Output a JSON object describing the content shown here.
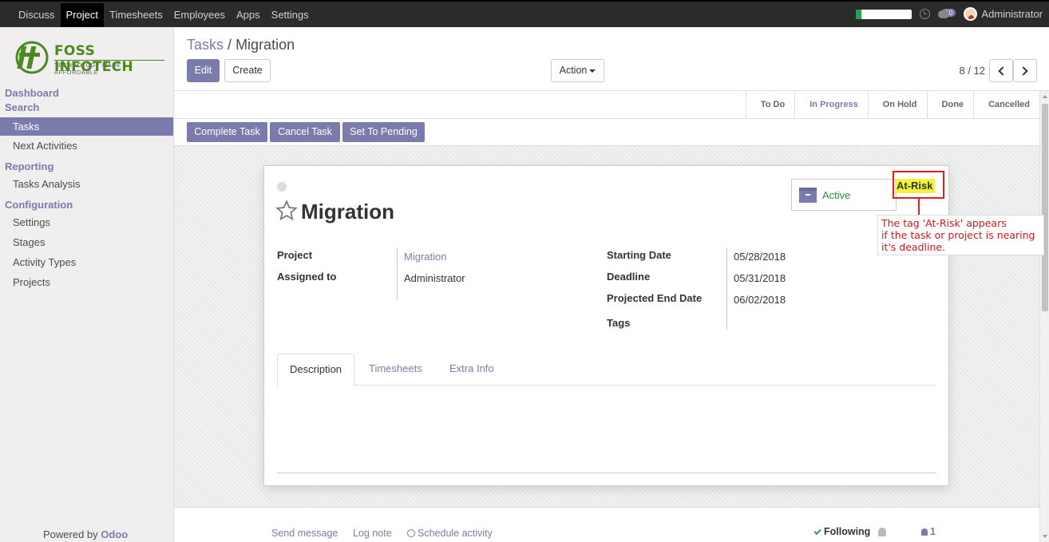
{
  "topbar": {
    "menu": [
      "Discuss",
      "Project",
      "Timesheets",
      "Employees",
      "Apps",
      "Settings"
    ],
    "active_menu": "Project",
    "notification_count": "10",
    "user": "Administrator",
    "progress": 0.1
  },
  "sidebar": {
    "logo_name": "FOSS INFOTECH",
    "logo_tagline": "TECHNOLOGY MADE AFFORDABLE",
    "sections": [
      {
        "title": "Dashboard",
        "items": []
      },
      {
        "title": "Search",
        "items": [
          "Tasks",
          "Next Activities"
        ]
      },
      {
        "title": "Reporting",
        "items": [
          "Tasks Analysis"
        ]
      },
      {
        "title": "Configuration",
        "items": [
          "Settings",
          "Stages",
          "Activity Types",
          "Projects"
        ]
      }
    ],
    "active_item": "Tasks",
    "powered_by": "Powered by",
    "powered_brand": "Odoo"
  },
  "control": {
    "breadcrumb_parent": "Tasks",
    "breadcrumb_sep": "/",
    "breadcrumb_current": "Migration",
    "edit_label": "Edit",
    "create_label": "Create",
    "action_label": "Action",
    "pager": "8 / 12"
  },
  "statusbar": {
    "buttons": [
      "Complete Task",
      "Cancel Task",
      "Set To Pending"
    ],
    "stages": [
      "To Do",
      "In Progress",
      "On Hold",
      "Done",
      "Cancelled"
    ],
    "current_stage": "In Progress"
  },
  "form": {
    "title": "Migration",
    "active_label": "Active",
    "tag": "At-Risk",
    "left_fields": [
      {
        "label": "Project",
        "value": "Migration"
      },
      {
        "label": "Assigned to",
        "value": "Administrator"
      }
    ],
    "right_fields": [
      {
        "label": "Starting Date",
        "value": "05/28/2018"
      },
      {
        "label": "Deadline",
        "value": "05/31/2018"
      },
      {
        "label": "Projected End Date",
        "value": "06/02/2018"
      },
      {
        "label": "Tags",
        "value": ""
      }
    ],
    "tabs": [
      "Description",
      "Timesheets",
      "Extra Info"
    ],
    "active_tab": "Description"
  },
  "chatter": {
    "send_message": "Send message",
    "log_note": "Log note",
    "schedule_activity": "Schedule activity",
    "following": "Following",
    "followers_count": "1"
  },
  "annotation": {
    "line1": "The tag 'At-Risk' appears",
    "line2": "if the task or project is nearing",
    "line3": "it's deadline."
  },
  "colors": {
    "accent": "#7c7bad",
    "navbar": "#2b2b2b",
    "tag_highlight": "#f3f33b",
    "annotation_red": "#e02020",
    "active_green": "#2c8c3c"
  }
}
